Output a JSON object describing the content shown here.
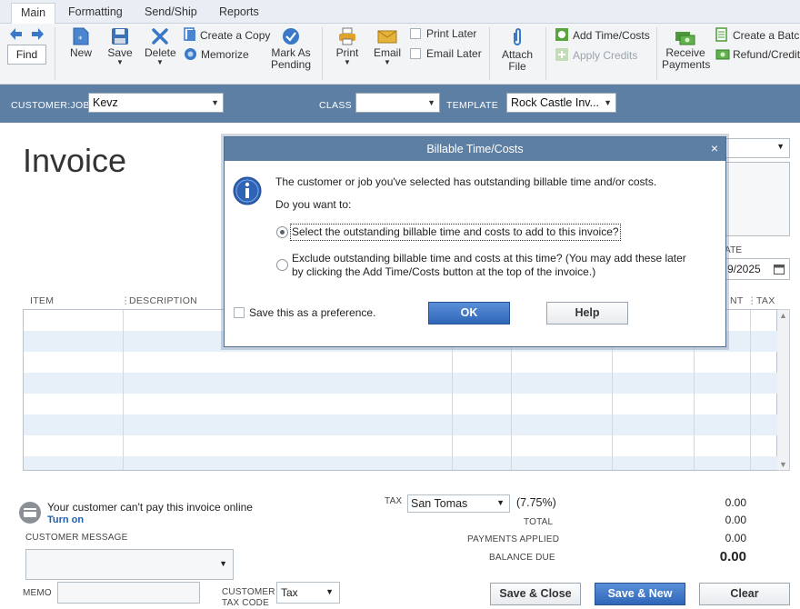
{
  "tabs": [
    "Main",
    "Formatting",
    "Send/Ship",
    "Reports"
  ],
  "toolbar": {
    "find": "Find",
    "new": "New",
    "save": "Save",
    "delete": "Delete",
    "create_copy": "Create a Copy",
    "memorize": "Memorize",
    "mark_as_pending_1": "Mark As",
    "mark_as_pending_2": "Pending",
    "print": "Print",
    "email": "Email",
    "print_later": "Print Later",
    "email_later": "Email Later",
    "attach_file_1": "Attach",
    "attach_file_2": "File",
    "add_time_costs": "Add Time/Costs",
    "apply_credits": "Apply Credits",
    "receive_payments_1": "Receive",
    "receive_payments_2": "Payments",
    "create_batch": "Create a Batch",
    "refund_credit": "Refund/Credit"
  },
  "header": {
    "customer_job_label": "CUSTOMER:JOB",
    "customer_job_value": "Kevz",
    "class_label": "CLASS",
    "class_value": "",
    "template_label": "TEMPLATE",
    "template_value": "Rock Castle Inv..."
  },
  "form": {
    "title": "Invoice",
    "date_label": "ATE",
    "date_value": "9/2025",
    "columns": {
      "item": "ITEM",
      "description": "DESCRIPTION",
      "amount_partial": "NT",
      "tax": "TAX"
    }
  },
  "online_pay": {
    "message": "Your customer can't pay this invoice online",
    "turn_on": "Turn on"
  },
  "footer": {
    "customer_message_label": "CUSTOMER MESSAGE",
    "memo_label": "MEMO",
    "customer_tax_code_label_1": "CUSTOMER",
    "customer_tax_code_label_2": "TAX CODE",
    "customer_tax_code_value": "Tax",
    "tax_label": "TAX",
    "tax_value": "San Tomas",
    "tax_rate": "(7.75%)",
    "tax_amount": "0.00",
    "total_label": "TOTAL",
    "total_value": "0.00",
    "payments_applied_label": "PAYMENTS APPLIED",
    "payments_applied_value": "0.00",
    "balance_due_label": "BALANCE DUE",
    "balance_due_value": "0.00",
    "save_close": "Save & Close",
    "save_new": "Save & New",
    "clear": "Clear"
  },
  "dialog": {
    "title": "Billable Time/Costs",
    "message": "The customer or job you've selected has outstanding billable time and/or costs.",
    "prompt": "Do you want to:",
    "option_select": "Select the outstanding billable time and costs to add to this invoice?",
    "option_exclude_1": "Exclude outstanding billable time and costs at this time? (You may add these later",
    "option_exclude_2": "by clicking the Add Time/Costs button at the top of the invoice.)",
    "save_preference": "Save this as a preference.",
    "ok": "OK",
    "help": "Help",
    "selected_option": "select"
  },
  "colors": {
    "header_band": "#5d7fa3",
    "primary_button": "#2f66b8",
    "alt_row": "#e7eff9"
  }
}
